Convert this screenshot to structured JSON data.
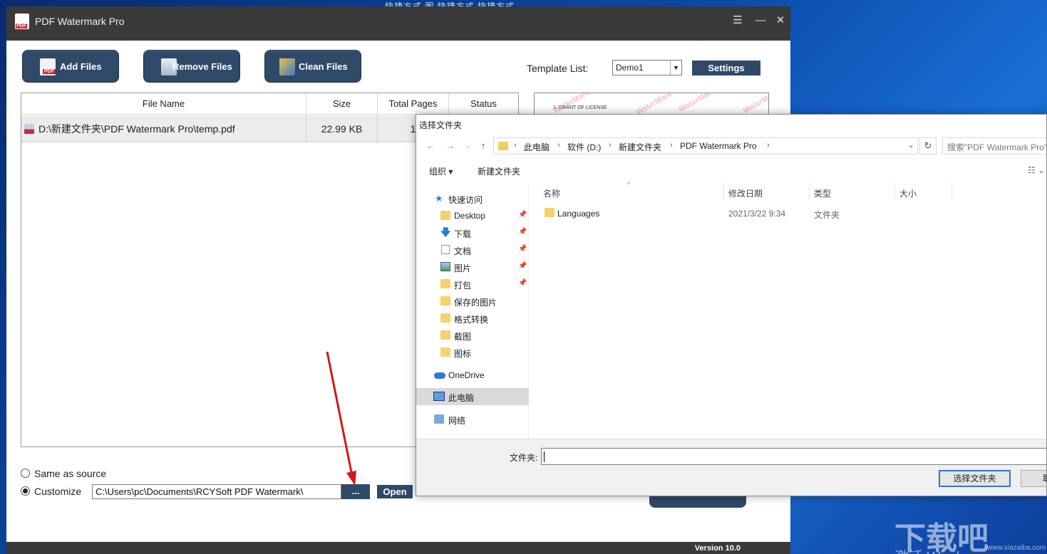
{
  "desktop": {
    "top_text": "快捷方式     图     快捷方式     快捷方式",
    "watermark": "下载吧",
    "site": "www.xiazaiba.com",
    "activate": "激活 Windows"
  },
  "app": {
    "title": "PDF Watermark Pro",
    "controls": {
      "menu": "☰",
      "minimize": "—",
      "close": "✕"
    },
    "toolbar": {
      "add_files": "Add Files",
      "remove_files": "Remove Files",
      "clean_files": "Clean Files"
    },
    "template": {
      "label": "Template List:",
      "selected": "Demo1",
      "settings": "Settings"
    },
    "grid": {
      "columns": [
        "File Name",
        "Size",
        "Total Pages",
        "Status"
      ],
      "rows": [
        {
          "file_name": "D:\\新建文件夹\\PDF Watermark Pro\\temp.pdf",
          "size": "22.99 KB",
          "total_pages": "1",
          "status": ""
        }
      ]
    },
    "preview": {
      "text": "1. GRANT OF LICENSE",
      "watermark": "WaterMark"
    },
    "output": {
      "same_as_source": "Same as source",
      "customize": "Customize",
      "path": "C:\\Users\\pc\\Documents\\RCYSoft PDF Watermark\\",
      "browse": "...",
      "open": "Open",
      "selected_option": "customize"
    },
    "footer": {
      "version": "Version 10.0"
    }
  },
  "dialog": {
    "title": "选择文件夹",
    "breadcrumbs": [
      "此电脑",
      "软件 (D:)",
      "新建文件夹",
      "PDF Watermark Pro"
    ],
    "search_placeholder": "搜索\"PDF Watermark Pro\"",
    "commands": {
      "organize": "组织 ▾",
      "new_folder": "新建文件夹"
    },
    "tree": {
      "quick_access": "快速访问",
      "items": [
        "Desktop",
        "下载",
        "文档",
        "图片",
        "打包",
        "保存的图片",
        "格式转换",
        "截图",
        "图标"
      ],
      "onedrive": "OneDrive",
      "this_pc": "此电脑",
      "network": "网络"
    },
    "columns": {
      "name": "名称",
      "date": "修改日期",
      "type": "类型",
      "size": "大小"
    },
    "files": [
      {
        "name": "Languages",
        "date": "2021/3/22 9:34",
        "type": "文件夹",
        "size": ""
      }
    ],
    "folder_label": "文件夹:",
    "folder_value": "",
    "ok": "选择文件夹",
    "cancel": "取消"
  },
  "colors": {
    "accent_button": "#2f4a68",
    "title_bar": "#3a3a3a",
    "arrow": "#d01a1a"
  }
}
